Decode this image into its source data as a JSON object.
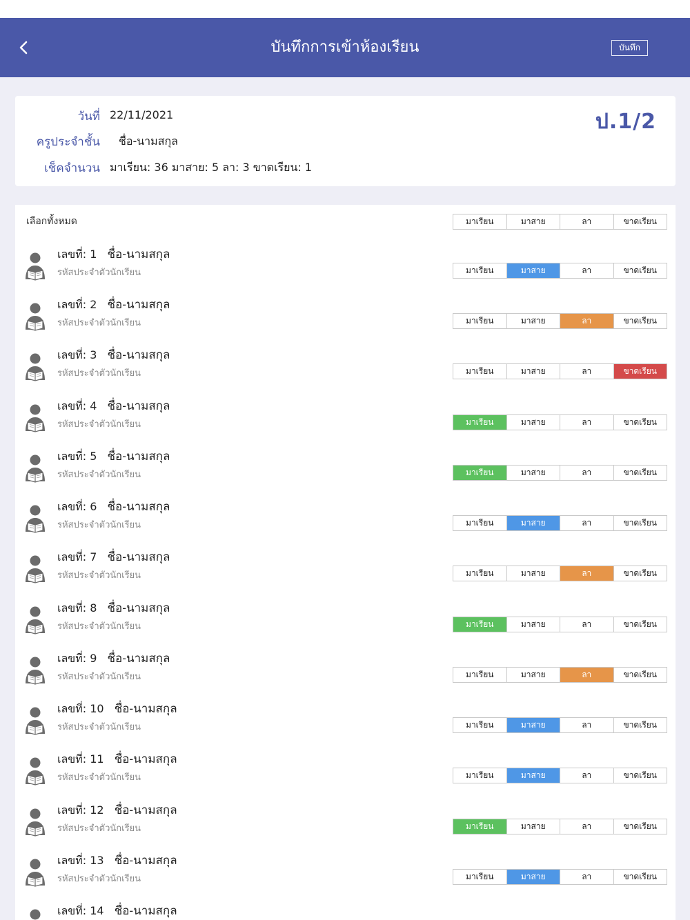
{
  "header": {
    "title": "บันทึกการเข้าห้องเรียน",
    "save_label": "บันทึก"
  },
  "info": {
    "date_label": "วันที่",
    "date_value": "22/11/2021",
    "teacher_label": "ครูประจำชั้น",
    "teacher_value": "ชื่อ-นามสกุล",
    "count_label": "เช็คจำนวน",
    "count_value": "มาเรียน: 36 มาสาย: 5 ลา: 3 ขาดเรียน: 1",
    "class_name": "ป.1/2"
  },
  "list": {
    "select_all_label": "เลือกทั้งหมด",
    "status_options": [
      "มาเรียน",
      "มาสาย",
      "ลา",
      "ขาดเรียน"
    ],
    "students": [
      {
        "number_text": "เลขที่: 1",
        "name": "ชื่อ-นามสกุล",
        "code": "รหัสประจำตัวนักเรียน",
        "status": 1
      },
      {
        "number_text": "เลขที่: 2",
        "name": "ชื่อ-นามสกุล",
        "code": "รหัสประจำตัวนักเรียน",
        "status": 2
      },
      {
        "number_text": "เลขที่: 3",
        "name": "ชื่อ-นามสกุล",
        "code": "รหัสประจำตัวนักเรียน",
        "status": 3
      },
      {
        "number_text": "เลขที่: 4",
        "name": "ชื่อ-นามสกุล",
        "code": "รหัสประจำตัวนักเรียน",
        "status": 0
      },
      {
        "number_text": "เลขที่: 5",
        "name": "ชื่อ-นามสกุล",
        "code": "รหัสประจำตัวนักเรียน",
        "status": 0
      },
      {
        "number_text": "เลขที่: 6",
        "name": "ชื่อ-นามสกุล",
        "code": "รหัสประจำตัวนักเรียน",
        "status": 1
      },
      {
        "number_text": "เลขที่: 7",
        "name": "ชื่อ-นามสกุล",
        "code": "รหัสประจำตัวนักเรียน",
        "status": 2
      },
      {
        "number_text": "เลขที่: 8",
        "name": "ชื่อ-นามสกุล",
        "code": "รหัสประจำตัวนักเรียน",
        "status": 0
      },
      {
        "number_text": "เลขที่: 9",
        "name": "ชื่อ-นามสกุล",
        "code": "รหัสประจำตัวนักเรียน",
        "status": 2
      },
      {
        "number_text": "เลขที่: 10",
        "name": "ชื่อ-นามสกุล",
        "code": "รหัสประจำตัวนักเรียน",
        "status": 1
      },
      {
        "number_text": "เลขที่: 11",
        "name": "ชื่อ-นามสกุล",
        "code": "รหัสประจำตัวนักเรียน",
        "status": 1
      },
      {
        "number_text": "เลขที่: 12",
        "name": "ชื่อ-นามสกุล",
        "code": "รหัสประจำตัวนักเรียน",
        "status": 0
      },
      {
        "number_text": "เลขที่: 13",
        "name": "ชื่อ-นามสกุล",
        "code": "รหัสประจำตัวนักเรียน",
        "status": 1
      },
      {
        "number_text": "เลขที่: 14",
        "name": "ชื่อ-นามสกุล",
        "code": "",
        "status": null
      }
    ]
  },
  "icons": {
    "back": "chevron-left-icon",
    "avatar": "student-reading-icon"
  },
  "colors": {
    "primary": "#4a58a8",
    "present": "#5cc15f",
    "late": "#4f97e6",
    "leave": "#e69549",
    "absent": "#d44a4a"
  }
}
